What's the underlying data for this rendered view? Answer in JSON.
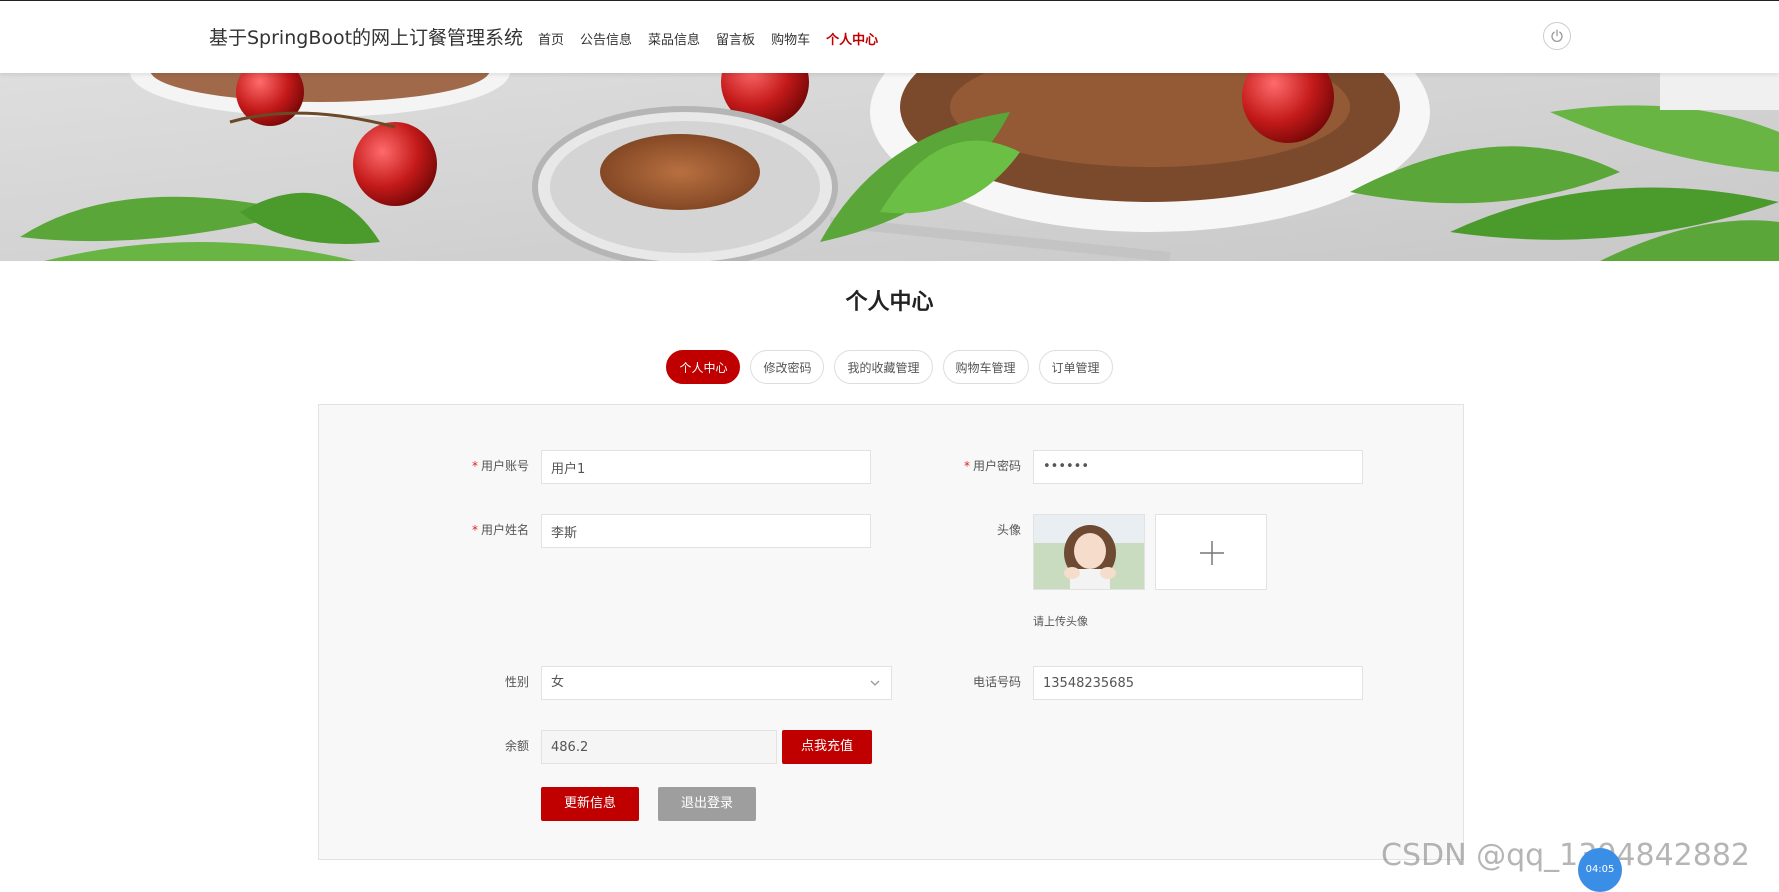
{
  "header": {
    "title": "基于SpringBoot的网上订餐管理系统",
    "nav": [
      "首页",
      "公告信息",
      "菜品信息",
      "留言板",
      "购物车",
      "个人中心"
    ],
    "active_nav": "个人中心",
    "power_icon": "power-icon"
  },
  "page_title": "个人中心",
  "tabs": [
    "个人中心",
    "修改密码",
    "我的收藏管理",
    "购物车管理",
    "订单管理"
  ],
  "form": {
    "account_label": "用户账号",
    "account_value": "用户1",
    "password_label": "用户密码",
    "password_value": "••••••",
    "name_label": "用户姓名",
    "name_value": "李斯",
    "avatar_label": "头像",
    "avatar_hint": "请上传头像",
    "gender_label": "性别",
    "gender_value": "女",
    "phone_label": "电话号码",
    "phone_value": "13548235685",
    "balance_label": "余额",
    "balance_value": "486.2",
    "recharge_label": "点我充值",
    "update_label": "更新信息",
    "logout_label": "退出登录"
  },
  "watermark": "CSDN @qq_1394842882",
  "float_badge": "04:05",
  "colors": {
    "accent": "#c00000",
    "gray_button": "#9e9e9e"
  }
}
